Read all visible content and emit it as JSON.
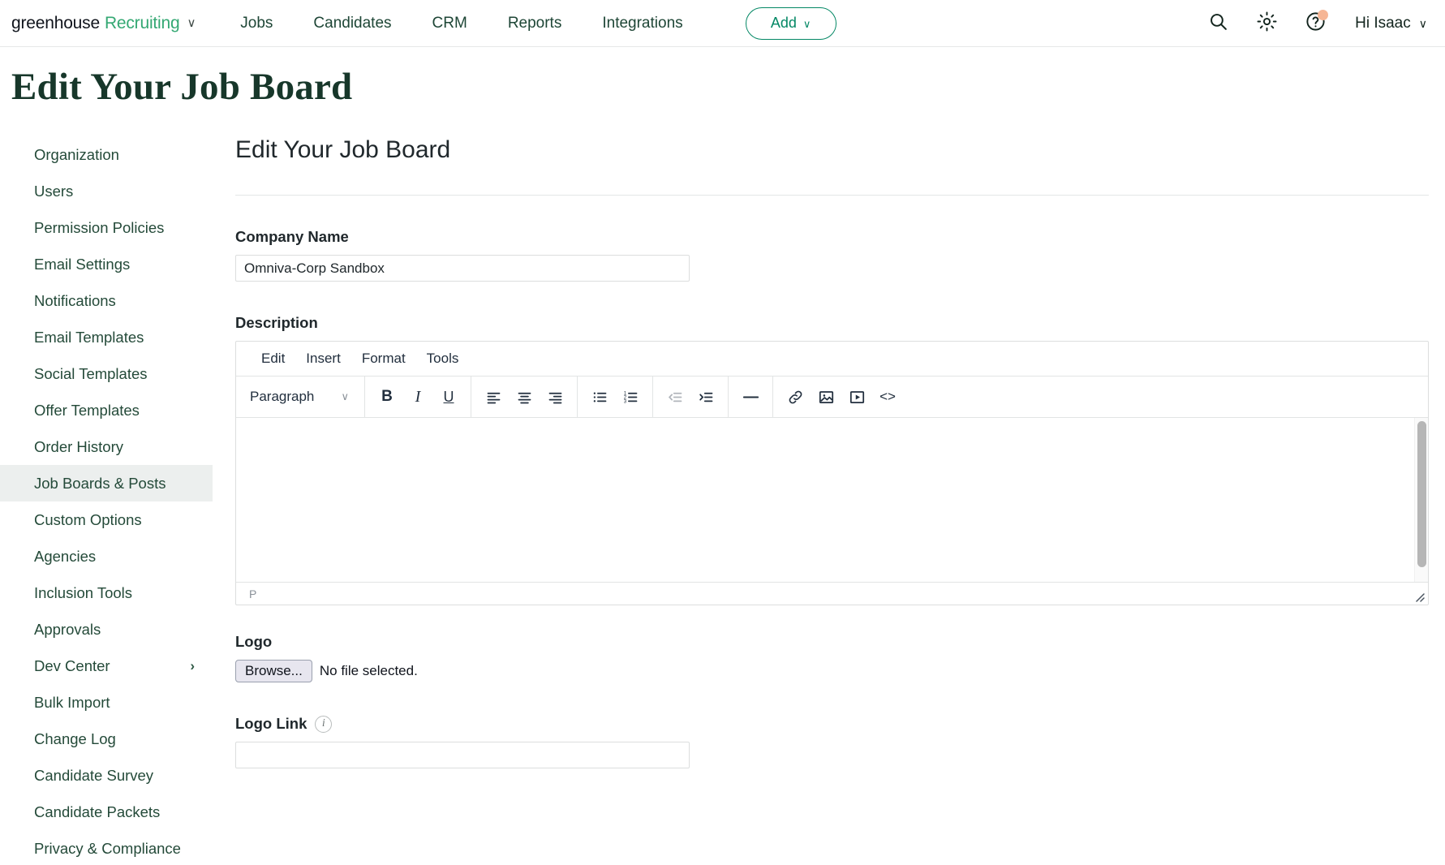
{
  "header": {
    "brand_primary": "greenhouse",
    "brand_secondary": "Recruiting",
    "brand_chevron": "∨",
    "nav": [
      {
        "label": "Jobs"
      },
      {
        "label": "Candidates"
      },
      {
        "label": "CRM"
      },
      {
        "label": "Reports"
      },
      {
        "label": "Integrations"
      }
    ],
    "add_button": {
      "label": "Add",
      "chevron": "∨"
    },
    "icons": {
      "search": "search-icon",
      "settings": "gear-icon",
      "help": "help-icon"
    },
    "user": {
      "label": "Hi Isaac",
      "chevron": "∨"
    },
    "colors": {
      "brand_green": "#34a873",
      "nav_text": "#1e4636",
      "add_accent": "#038764",
      "notification_dot": "#f6b695"
    }
  },
  "page": {
    "title": "Edit Your Job Board",
    "heading": "Edit Your Job Board"
  },
  "sidebar": {
    "items": [
      {
        "label": "Organization",
        "active": false,
        "chevron": ""
      },
      {
        "label": "Users",
        "active": false,
        "chevron": ""
      },
      {
        "label": "Permission Policies",
        "active": false,
        "chevron": ""
      },
      {
        "label": "Email Settings",
        "active": false,
        "chevron": ""
      },
      {
        "label": "Notifications",
        "active": false,
        "chevron": ""
      },
      {
        "label": "Email Templates",
        "active": false,
        "chevron": ""
      },
      {
        "label": "Social Templates",
        "active": false,
        "chevron": ""
      },
      {
        "label": "Offer Templates",
        "active": false,
        "chevron": ""
      },
      {
        "label": "Order History",
        "active": false,
        "chevron": ""
      },
      {
        "label": "Job Boards & Posts",
        "active": true,
        "chevron": ""
      },
      {
        "label": "Custom Options",
        "active": false,
        "chevron": ""
      },
      {
        "label": "Agencies",
        "active": false,
        "chevron": ""
      },
      {
        "label": "Inclusion Tools",
        "active": false,
        "chevron": ""
      },
      {
        "label": "Approvals",
        "active": false,
        "chevron": ""
      },
      {
        "label": "Dev Center",
        "active": false,
        "chevron": "›"
      },
      {
        "label": "Bulk Import",
        "active": false,
        "chevron": ""
      },
      {
        "label": "Change Log",
        "active": false,
        "chevron": ""
      },
      {
        "label": "Candidate Survey",
        "active": false,
        "chevron": ""
      },
      {
        "label": "Candidate Packets",
        "active": false,
        "chevron": ""
      },
      {
        "label": "Privacy & Compliance",
        "active": false,
        "chevron": ""
      }
    ]
  },
  "form": {
    "company_name": {
      "label": "Company Name",
      "value": "Omniva-Corp Sandbox",
      "placeholder": ""
    },
    "description": {
      "label": "Description",
      "content": "",
      "status_path": "P"
    },
    "logo": {
      "label": "Logo",
      "browse_label": "Browse...",
      "file_status": "No file selected."
    },
    "logo_link": {
      "label": "Logo Link",
      "info_glyph": "i",
      "value": "",
      "placeholder": ""
    }
  },
  "editor": {
    "menus": [
      {
        "label": "Edit"
      },
      {
        "label": "Insert"
      },
      {
        "label": "Format"
      },
      {
        "label": "Tools"
      }
    ],
    "block_format": {
      "label": "Paragraph",
      "chevron": "∨"
    },
    "toolbar_groups": [
      {
        "buttons": [
          {
            "name": "bold-icon",
            "label": "B",
            "style": "bold",
            "disabled": false
          },
          {
            "name": "italic-icon",
            "label": "I",
            "style": "italic",
            "disabled": false
          },
          {
            "name": "underline-icon",
            "label": "U",
            "style": "underline",
            "disabled": false
          }
        ]
      },
      {
        "buttons": [
          {
            "name": "align-left-icon",
            "label": "",
            "style": "svg-align-left",
            "disabled": false
          },
          {
            "name": "align-center-icon",
            "label": "",
            "style": "svg-align-center",
            "disabled": false
          },
          {
            "name": "align-right-icon",
            "label": "",
            "style": "svg-align-right",
            "disabled": false
          }
        ]
      },
      {
        "buttons": [
          {
            "name": "bullet-list-icon",
            "label": "",
            "style": "svg-bullet-list",
            "disabled": false
          },
          {
            "name": "numbered-list-icon",
            "label": "",
            "style": "svg-numbered-list",
            "disabled": false
          }
        ]
      },
      {
        "buttons": [
          {
            "name": "outdent-icon",
            "label": "",
            "style": "svg-outdent",
            "disabled": true
          },
          {
            "name": "indent-icon",
            "label": "",
            "style": "svg-indent",
            "disabled": false
          }
        ]
      },
      {
        "buttons": [
          {
            "name": "horizontal-rule-icon",
            "label": "",
            "style": "svg-hr",
            "disabled": false
          }
        ]
      },
      {
        "buttons": [
          {
            "name": "link-icon",
            "label": "",
            "style": "svg-link",
            "disabled": false
          },
          {
            "name": "image-icon",
            "label": "",
            "style": "svg-image",
            "disabled": false
          },
          {
            "name": "media-icon",
            "label": "",
            "style": "svg-media",
            "disabled": false
          },
          {
            "name": "source-code-icon",
            "label": "<>",
            "style": "code",
            "disabled": false
          }
        ]
      }
    ]
  }
}
